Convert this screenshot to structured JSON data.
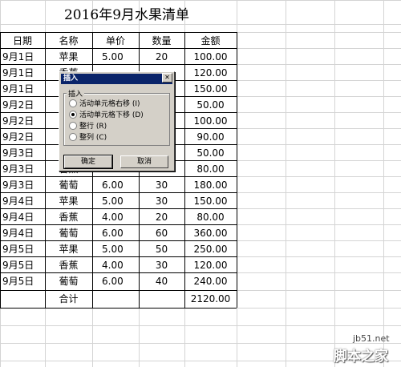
{
  "sheet": {
    "title": "2016年9月水果清单",
    "headers": [
      "日期",
      "名称",
      "单价",
      "数量",
      "金额"
    ],
    "rows": [
      [
        "9月1日",
        "苹果",
        "5.00",
        "20",
        "100.00"
      ],
      [
        "9月1日",
        "香蕉",
        "",
        "",
        "120.00"
      ],
      [
        "9月1日",
        "",
        "",
        "",
        "150.00"
      ],
      [
        "9月2日",
        "",
        "",
        "",
        "50.00"
      ],
      [
        "9月2日",
        "",
        "",
        "",
        "100.00"
      ],
      [
        "9月2日",
        "",
        "",
        "",
        "90.00"
      ],
      [
        "9月3日",
        "",
        "",
        "",
        "50.00"
      ],
      [
        "9月3日",
        "香蕉",
        "",
        "",
        "80.00"
      ],
      [
        "9月3日",
        "葡萄",
        "6.00",
        "30",
        "180.00"
      ],
      [
        "9月4日",
        "苹果",
        "5.00",
        "30",
        "150.00"
      ],
      [
        "9月4日",
        "香蕉",
        "4.00",
        "20",
        "80.00"
      ],
      [
        "9月4日",
        "葡萄",
        "6.00",
        "60",
        "360.00"
      ],
      [
        "9月5日",
        "苹果",
        "5.00",
        "50",
        "250.00"
      ],
      [
        "9月5日",
        "香蕉",
        "4.00",
        "30",
        "120.00"
      ],
      [
        "9月5日",
        "葡萄",
        "6.00",
        "40",
        "240.00"
      ]
    ],
    "total_label": "合计",
    "total_value": "2120.00"
  },
  "dialog": {
    "title": "插入",
    "close_label": "✕",
    "group_label": "插入",
    "options": [
      {
        "label": "活动单元格右移 (I)",
        "selected": false
      },
      {
        "label": "活动单元格下移 (D)",
        "selected": true
      },
      {
        "label": "整行 (R)",
        "selected": false
      },
      {
        "label": "整列 (C)",
        "selected": false
      }
    ],
    "ok_label": "确定",
    "cancel_label": "取消"
  },
  "watermark": {
    "line1": "jb51.net",
    "line2": "脚本之家"
  }
}
